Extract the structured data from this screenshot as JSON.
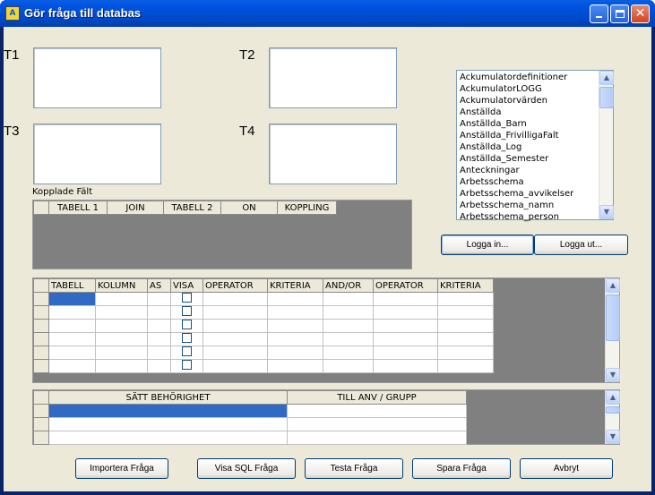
{
  "window": {
    "title": "Gör fråga till databas",
    "app_icon": "A"
  },
  "labels": {
    "t1": "T1",
    "t2": "T2",
    "t3": "T3",
    "t4": "T4",
    "kopplade": "Kopplade Fält"
  },
  "tables_list": [
    "Ackumulatordefinitioner",
    "AckumulatorLOGG",
    "Ackumulatorvärden",
    "Anställda",
    "Anställda_Barn",
    "Anställda_FrivilligaFalt",
    "Anställda_Log",
    "Anställda_Semester",
    "Anteckningar",
    "Arbetsschema",
    "Arbetsschema_avvikelser",
    "Arbetsschema_namn",
    "Arbetsschema_person"
  ],
  "login": {
    "login_label": "Logga in...",
    "logout_label": "Logga ut..."
  },
  "join_grid": {
    "columns": [
      "TABELL 1",
      "JOIN",
      "TABELL 2",
      "ON",
      "KOPPLING"
    ]
  },
  "query_grid": {
    "columns": [
      "TABELL",
      "KOLUMN",
      "AS",
      "VISA",
      "OPERATOR",
      "KRITERIA",
      "AND/OR",
      "OPERATOR",
      "KRITERIA"
    ]
  },
  "perm_grid": {
    "columns": [
      "SÄTT BEHÖRIGHET",
      "TILL ANV / GRUPP"
    ]
  },
  "buttons": {
    "import": "Importera Fråga",
    "show_sql": "Visa SQL Fråga",
    "test": "Testa Fråga",
    "save": "Spara Fråga",
    "cancel": "Avbryt"
  }
}
